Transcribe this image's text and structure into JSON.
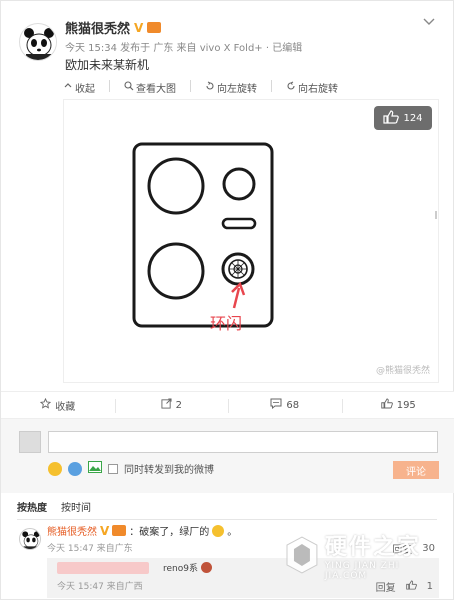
{
  "post": {
    "author": "熊猫很秃然",
    "v_badge": "V",
    "meta": "今天 15:34 发布于 广东 来自 vivo X Fold+ · 已编辑",
    "text": "欧加未来某新机"
  },
  "image_toolbar": {
    "collect": "收起",
    "view_large": "查看大图",
    "rotate_left": "向左旋转",
    "rotate_right": "向右旋转"
  },
  "image": {
    "like_count": "124",
    "annotation": "环闪",
    "watermark": "@熊猫很秃然"
  },
  "actions": {
    "favorite": "收藏",
    "repost": "2",
    "comment": "68",
    "like": "195"
  },
  "compose": {
    "input_value": "",
    "repost_label": "同时转发到我的微博",
    "submit": "评论"
  },
  "sort": {
    "hot": "按热度",
    "time": "按时间"
  },
  "comment": {
    "author": "熊猫很秃然",
    "v_badge": "V",
    "text": "：破案了，绿厂的",
    "suffix": "。",
    "meta": "今天 15:47 来自广东",
    "reply_label": "回复",
    "like_count": "30"
  },
  "reply": {
    "text": "reno9系",
    "meta": "今天 15:47 来自广西",
    "reply_label": "回复",
    "like_count": "1"
  },
  "site": {
    "name": "硬件之家",
    "sub": "YING JIAN ZHI JIA.COM"
  },
  "colors": {
    "accent": "#e55a20",
    "submit_bg": "#f7b38d",
    "annotation": "#e8464e"
  }
}
